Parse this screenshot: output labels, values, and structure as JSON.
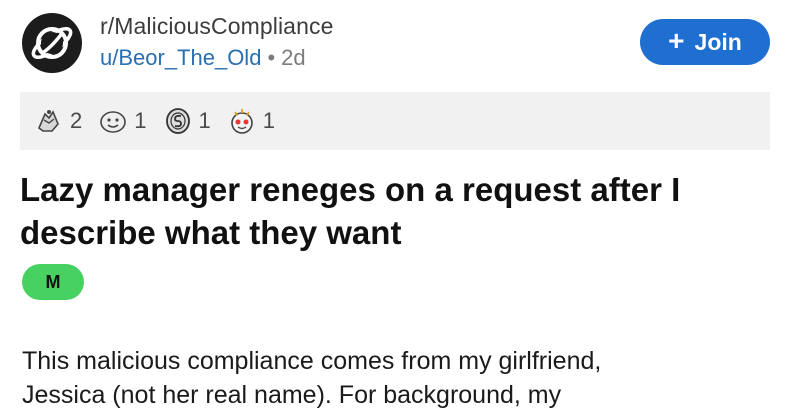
{
  "post": {
    "subreddit": "r/MaliciousCompliance",
    "username": "u/Beor_The_Old",
    "separator": "•",
    "age": "2d",
    "join_label": "Join",
    "join_icon": "+",
    "title": "Lazy manager reneges on a request after I describe what they want",
    "flair": "M",
    "body_lines": [
      "This malicious compliance comes from my girlfriend,",
      "Jessica (not her real name). For background, my"
    ]
  },
  "awards": [
    {
      "icon": "gold-hands-icon",
      "count": "2"
    },
    {
      "icon": "smiley-face-icon",
      "count": "1"
    },
    {
      "icon": "silver-coin-icon",
      "count": "1"
    },
    {
      "icon": "wholesome-icon",
      "count": "1"
    }
  ],
  "colors": {
    "accent": "#1f6fd0",
    "username": "#2a6fb0",
    "flair": "#46d160",
    "awards_bar": "#f1f1f2"
  }
}
